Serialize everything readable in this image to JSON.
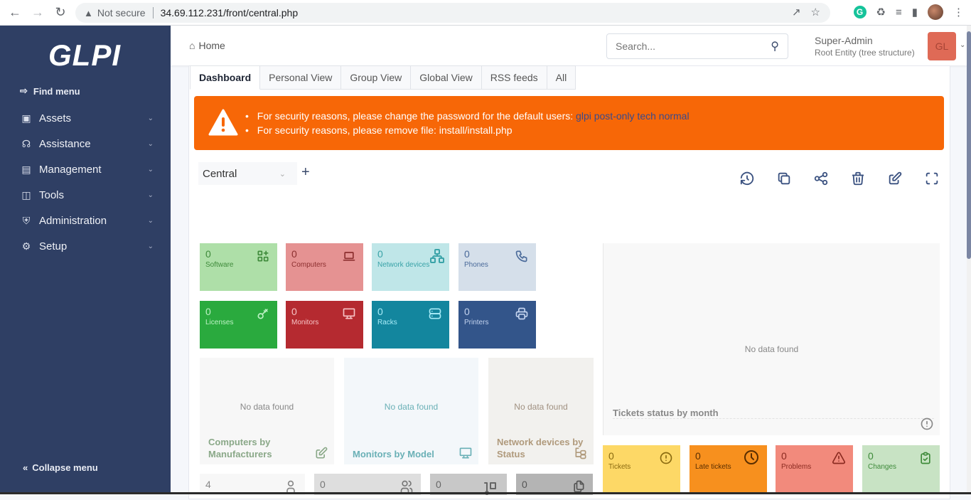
{
  "browser": {
    "security_label": "Not secure",
    "url": "34.69.112.231/front/central.php"
  },
  "sidebar": {
    "logo": "GLPI",
    "find_menu": "Find menu",
    "items": [
      {
        "label": "Assets",
        "icon": "box-icon"
      },
      {
        "label": "Assistance",
        "icon": "headset-icon"
      },
      {
        "label": "Management",
        "icon": "wallet-icon"
      },
      {
        "label": "Tools",
        "icon": "briefcase-icon"
      },
      {
        "label": "Administration",
        "icon": "shield-check-icon"
      },
      {
        "label": "Setup",
        "icon": "gear-icon"
      }
    ],
    "collapse": "Collapse menu"
  },
  "header": {
    "breadcrumb": "Home",
    "search_placeholder": "Search...",
    "user_name": "Super-Admin",
    "entity": "Root Entity (tree structure)",
    "avatar_initials": "GL"
  },
  "tabs": [
    "Dashboard",
    "Personal View",
    "Group View",
    "Global View",
    "RSS feeds",
    "All"
  ],
  "alert": {
    "line1_prefix": "For security reasons, please change the password for the default users:",
    "line1_users": "glpi post-only tech normal",
    "line2": "For security reasons, please remove file: install/install.php"
  },
  "dashboard": {
    "selected": "Central",
    "add_label": "+"
  },
  "tiles": [
    {
      "count": "0",
      "label": "Software",
      "bg": "#aedfa8",
      "fg": "#3e8a3a"
    },
    {
      "count": "0",
      "label": "Computers",
      "bg": "#e59292",
      "fg": "#8c2f2f"
    },
    {
      "count": "0",
      "label": "Network devices",
      "bg": "#bfe6e8",
      "fg": "#3aa3a8"
    },
    {
      "count": "0",
      "label": "Phones",
      "bg": "#d5dfea",
      "fg": "#4a6a9a"
    },
    {
      "count": "0",
      "label": "Licenses",
      "bg": "#2aaa3e",
      "fg": "#bdf2c4"
    },
    {
      "count": "0",
      "label": "Monitors",
      "bg": "#b52a30",
      "fg": "#f6c3c5"
    },
    {
      "count": "0",
      "label": "Racks",
      "bg": "#13869e",
      "fg": "#a8ecf8"
    },
    {
      "count": "0",
      "label": "Printers",
      "bg": "#33558a",
      "fg": "#c3d3ee"
    }
  ],
  "charts": [
    {
      "title": "Computers by Manufacturers",
      "nodata": "No data found",
      "bg": "#f7f7f7",
      "fg": "#8aa888",
      "nd": "#888888"
    },
    {
      "title": "Monitors by Model",
      "nodata": "No data found",
      "bg": "#f3f7fa",
      "fg": "#6ab0b6",
      "nd": "#6ab0b6"
    },
    {
      "title": "Network devices by Status",
      "nodata": "No data found",
      "bg": "#f2f1ee",
      "fg": "#b09a7c",
      "nd": "#a09080"
    }
  ],
  "big_chart": {
    "title": "Tickets status by month",
    "nodata": "No data found"
  },
  "ticket_tiles": [
    {
      "count": "0",
      "label": "Tickets",
      "bg": "#fdd866",
      "fg": "#8a6a10"
    },
    {
      "count": "0",
      "label": "Late tickets",
      "bg": "#f7901e",
      "fg": "#5a2e00"
    },
    {
      "count": "0",
      "label": "Problems",
      "bg": "#f28a7c",
      "fg": "#8a2a20"
    },
    {
      "count": "0",
      "label": "Changes",
      "bg": "#c8e3c4",
      "fg": "#3e8a3a"
    }
  ],
  "bottom_tiles": [
    {
      "count": "4",
      "bg": "#f7f7f7",
      "fg": "#888"
    },
    {
      "count": "0",
      "bg": "#dedede",
      "fg": "#777"
    },
    {
      "count": "0",
      "bg": "#c8c8c8",
      "fg": "#666"
    },
    {
      "count": "0",
      "bg": "#b4b4b4",
      "fg": "#555"
    }
  ]
}
